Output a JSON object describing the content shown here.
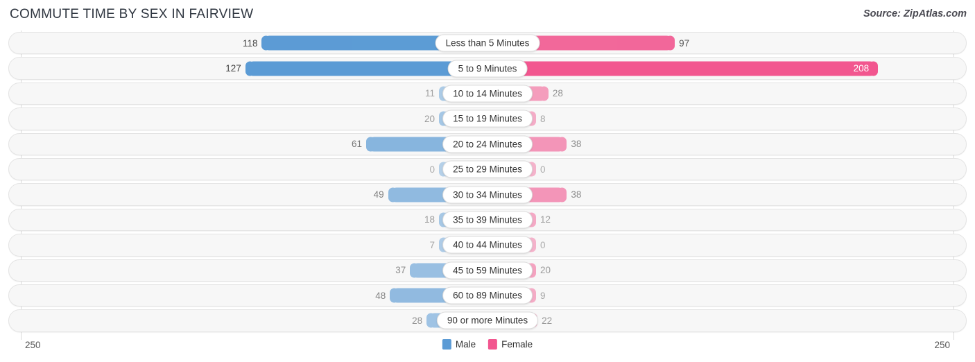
{
  "header": {
    "title": "COMMUTE TIME BY SEX IN FAIRVIEW",
    "source": "Source: ZipAtlas.com"
  },
  "footer": {
    "axis_left": "250",
    "axis_right": "250",
    "legend": [
      {
        "label": "Male",
        "color": "#5b9bd5"
      },
      {
        "label": "Female",
        "color": "#f2568f"
      }
    ]
  },
  "chart_data": {
    "type": "bar",
    "title": "COMMUTE TIME BY SEX IN FAIRVIEW",
    "subtitle": "",
    "orientation": "horizontal",
    "layout": "diverging-bidirectional",
    "xlabel": "",
    "ylabel": "",
    "axis_max": 250,
    "xlim": [
      250,
      250
    ],
    "grid": false,
    "legend_position": "bottom-center",
    "categories": [
      "Less than 5 Minutes",
      "5 to 9 Minutes",
      "10 to 14 Minutes",
      "15 to 19 Minutes",
      "20 to 24 Minutes",
      "25 to 29 Minutes",
      "30 to 34 Minutes",
      "35 to 39 Minutes",
      "40 to 44 Minutes",
      "45 to 59 Minutes",
      "60 to 89 Minutes",
      "90 or more Minutes"
    ],
    "series": [
      {
        "name": "Male",
        "color": "#5b9bd5",
        "side": "left",
        "values": [
          118,
          127,
          11,
          20,
          61,
          0,
          49,
          18,
          7,
          37,
          48,
          28
        ]
      },
      {
        "name": "Female",
        "color": "#f2568f",
        "side": "right",
        "values": [
          97,
          208,
          28,
          8,
          38,
          0,
          38,
          12,
          0,
          20,
          9,
          22
        ]
      }
    ]
  }
}
